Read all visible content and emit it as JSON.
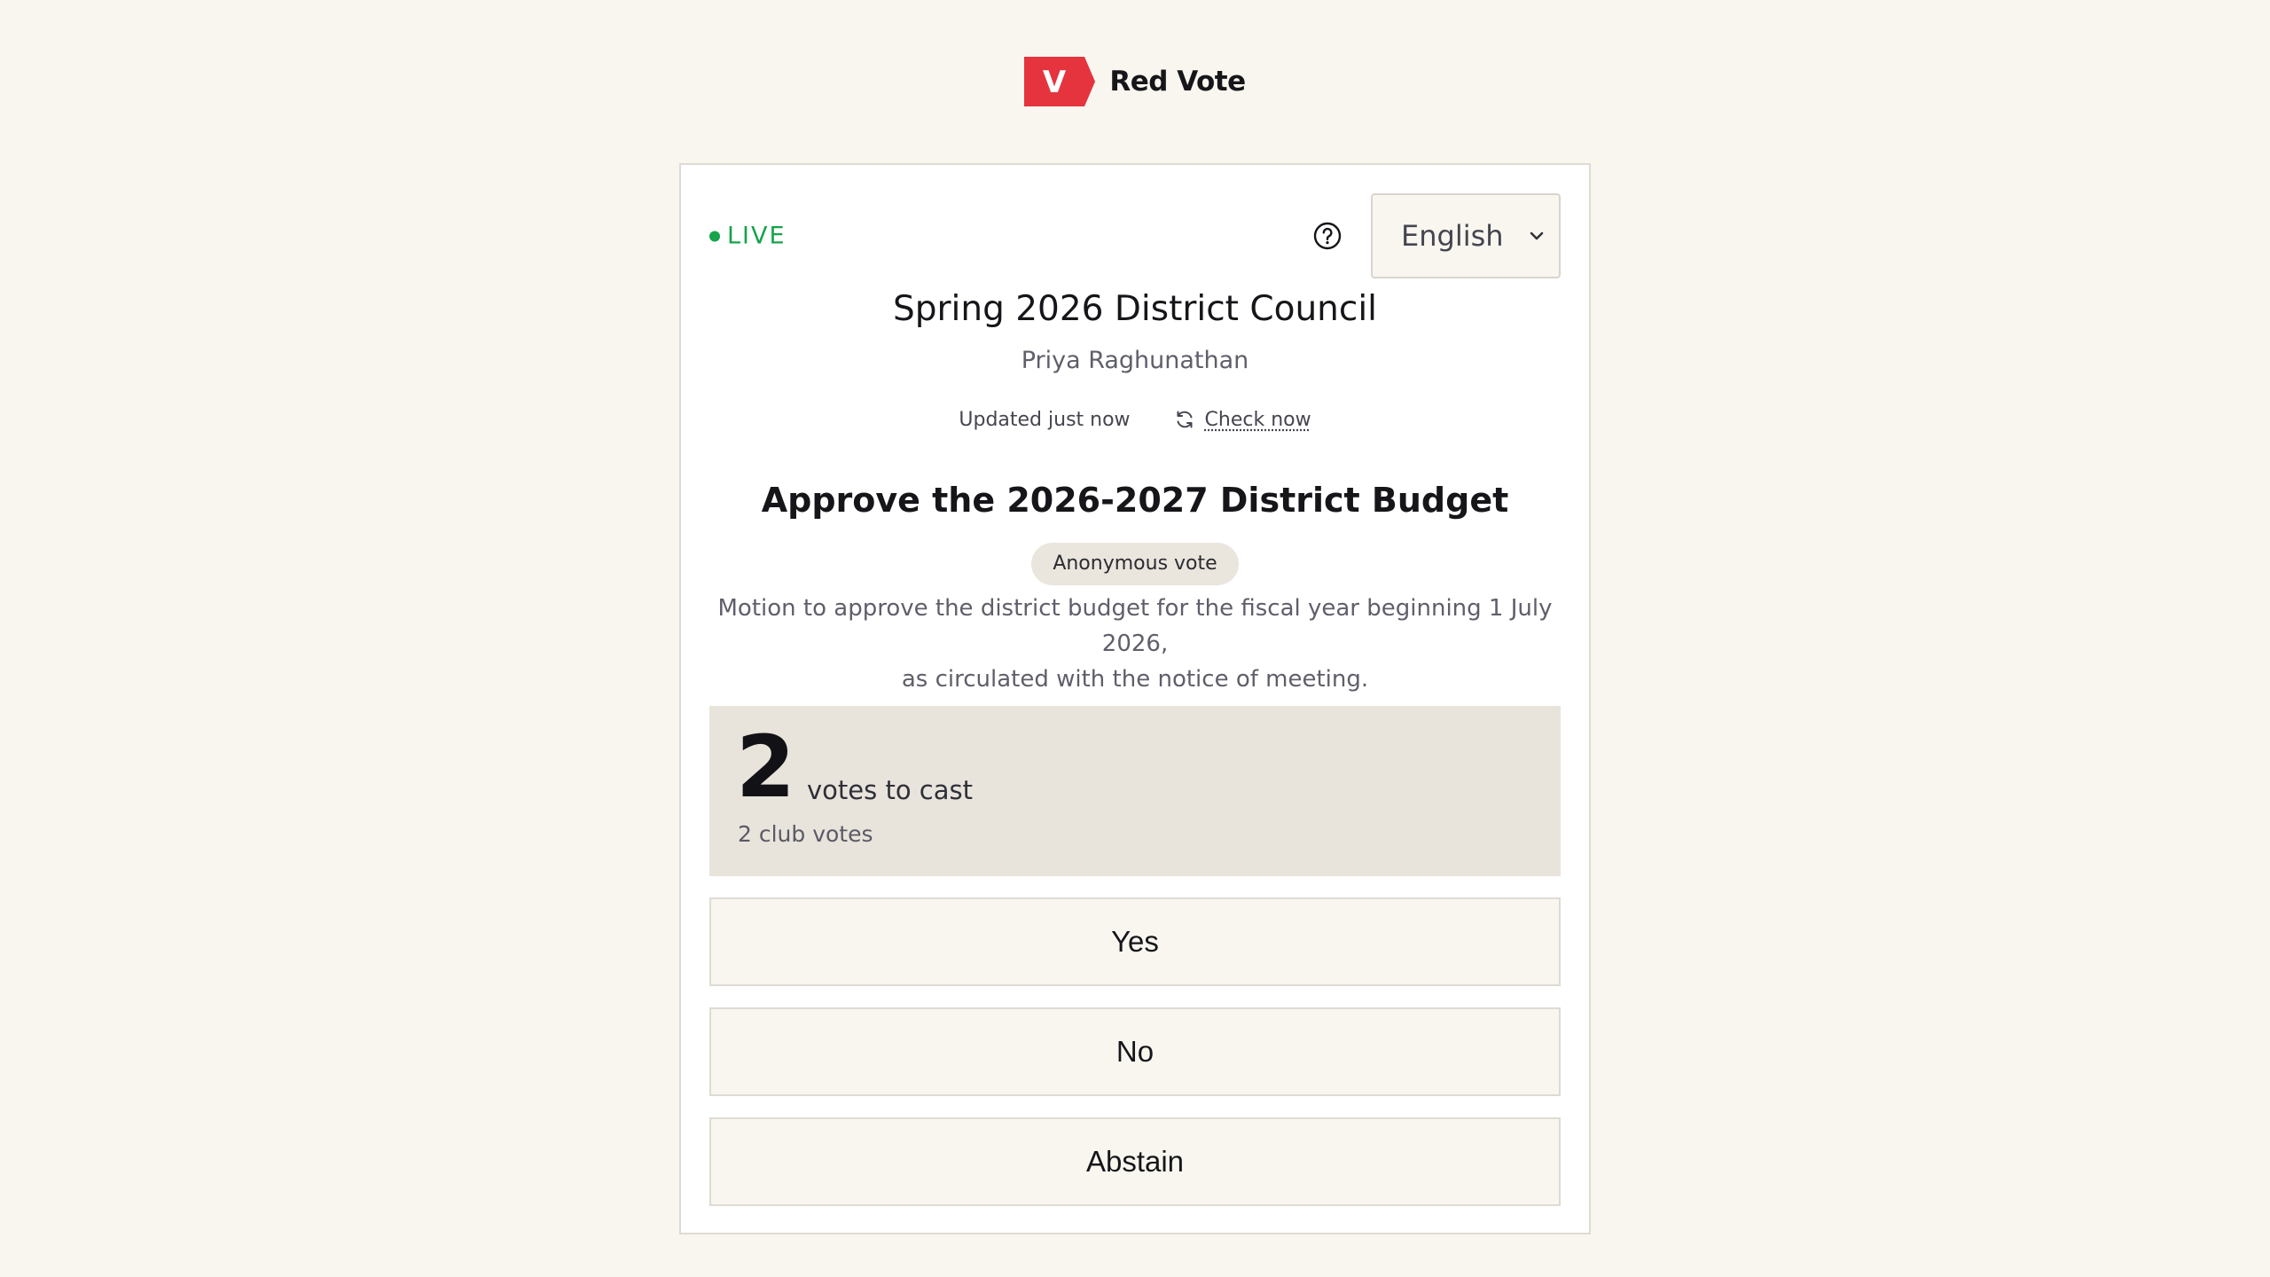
{
  "brand": {
    "logo_letter": "V",
    "name": "Red Vote",
    "color": "#e5343e"
  },
  "status": {
    "live_label": "LIVE",
    "live_color": "#16a34a"
  },
  "help": {
    "icon": "help-circle-icon"
  },
  "language": {
    "selected": "English",
    "icon": "chevron-down-icon"
  },
  "meeting": {
    "title": "Spring 2026 District Council",
    "chair": "Priya Raghunathan"
  },
  "update": {
    "status_text": "Updated just now",
    "refresh_icon": "refresh-icon",
    "check_now_label": "Check now"
  },
  "motion": {
    "title": "Approve the 2026-2027 District Budget",
    "badge": "Anonymous vote",
    "description_line1": "Motion to approve the district budget for the fiscal year beginning 1 July 2026,",
    "description_line2": "as circulated with the notice of meeting."
  },
  "votes": {
    "count": "2",
    "label": "votes to cast",
    "sub": "2 club votes"
  },
  "choices": [
    {
      "label": "Yes"
    },
    {
      "label": "No"
    },
    {
      "label": "Abstain"
    }
  ]
}
